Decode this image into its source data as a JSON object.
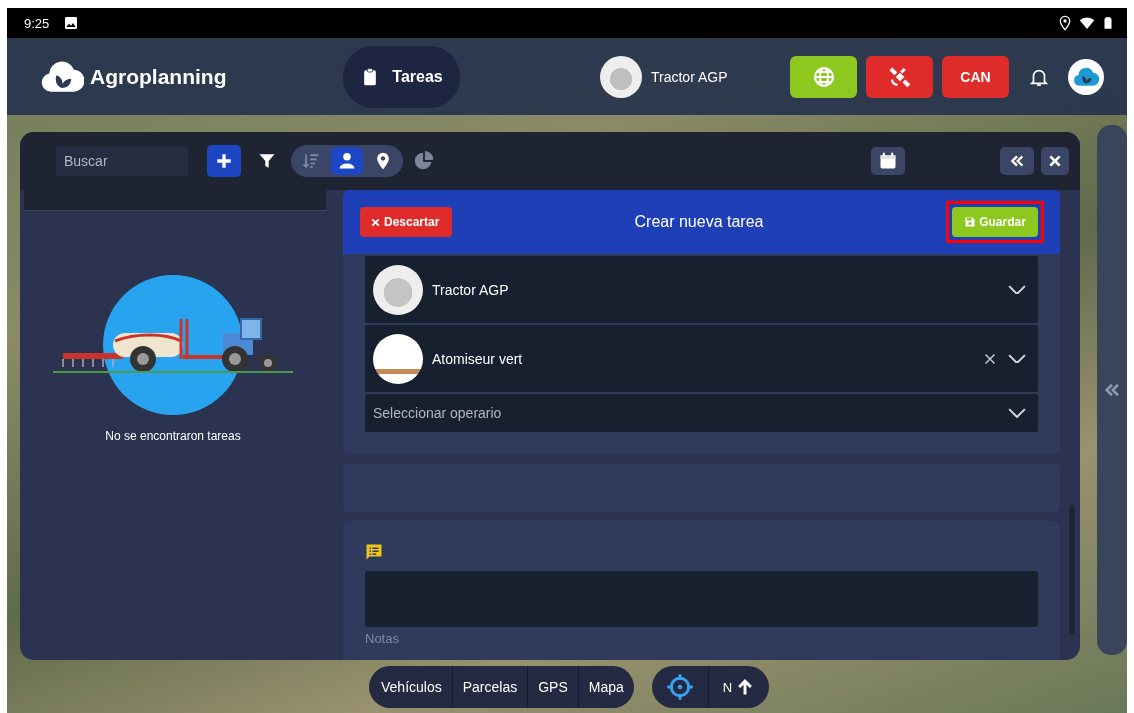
{
  "status_bar": {
    "time": "9:25"
  },
  "header": {
    "logo": "Agroplanning",
    "section": "Tareas",
    "vehicle": "Tractor AGP",
    "status_buttons": [
      {
        "kind": "globe",
        "color": "#8cc81e"
      },
      {
        "kind": "satellite",
        "color": "#e02b2b"
      },
      {
        "kind": "text",
        "label": "CAN",
        "color": "#e02b2b"
      }
    ]
  },
  "toolbar": {
    "search": {
      "placeholder": "Buscar"
    },
    "view_toggle": [
      {
        "kind": "sort",
        "selected": false
      },
      {
        "kind": "person",
        "selected": true
      },
      {
        "kind": "pin",
        "selected": false
      }
    ]
  },
  "task_list": {
    "empty_message": "No se encontraron tareas"
  },
  "form": {
    "title": "Crear nueva tarea",
    "discard": "Descartar",
    "save": "Guardar",
    "save_highlighted": true,
    "fields": [
      {
        "kind": "vehicle",
        "value": "Tractor AGP",
        "clearable": false
      },
      {
        "kind": "implement",
        "value": "Atomiseur vert",
        "clearable": true
      },
      {
        "kind": "operator",
        "placeholder": "Seleccionar operario",
        "clearable": false
      }
    ],
    "notes": {
      "label": "Notas"
    }
  },
  "bottom_nav": {
    "tabs": [
      "Vehículos",
      "Parcelas",
      "GPS",
      "Mapa"
    ],
    "compass": "N"
  }
}
